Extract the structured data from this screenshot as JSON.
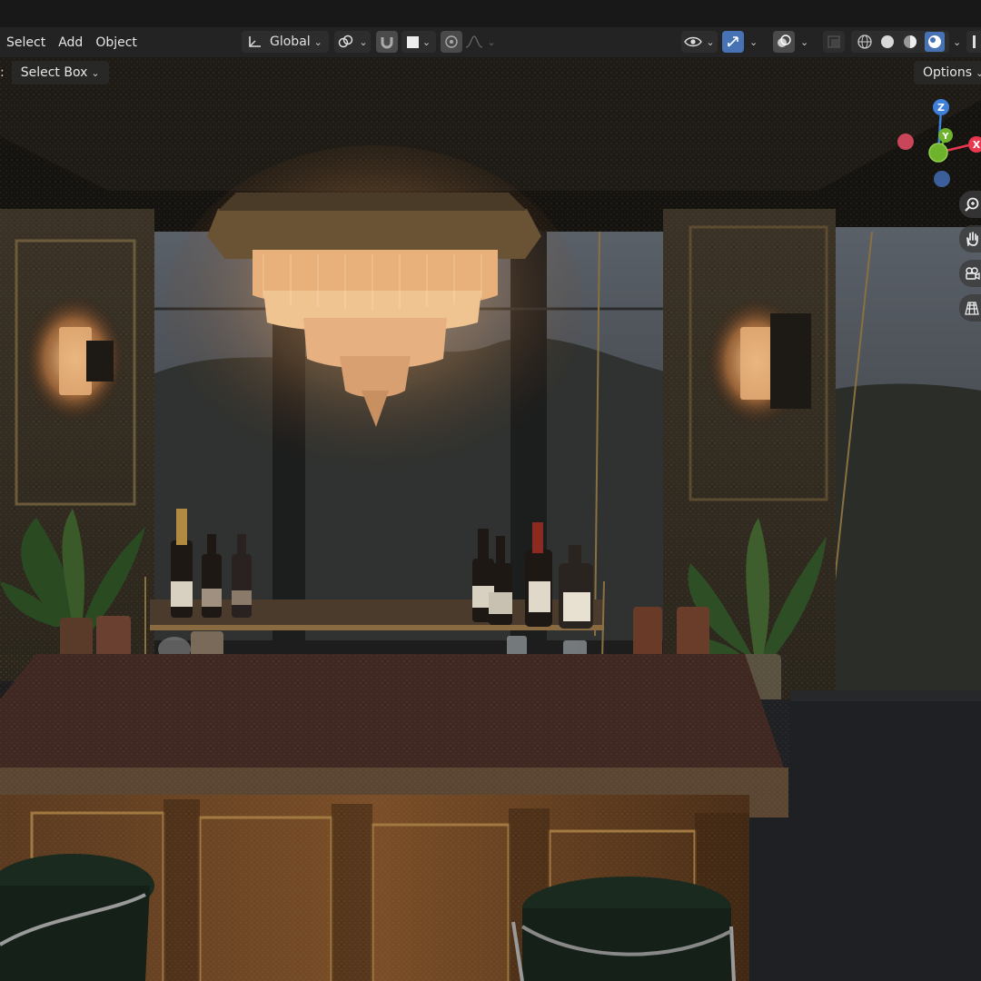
{
  "header": {
    "menu": [
      "Select",
      "Add",
      "Object"
    ],
    "transform_orientation": "Global"
  },
  "toolbar": {
    "mode_prefix": ":",
    "select_tool": "Select Box",
    "options_label": "Options"
  },
  "gizmo": {
    "z_label": "Z",
    "y_label": "Y",
    "x_label": "X"
  },
  "icons": {
    "transform": "axes-icon",
    "pivot": "link-icon",
    "snap": "magnet-icon",
    "proportional": "proportional-edit-icon",
    "visibility": "eye-icon",
    "gizmos": "gizmo-icon",
    "overlays": "overlay-icon",
    "xray": "xray-icon",
    "shading_wire": "wireframe-icon",
    "shading_solid": "solid-icon",
    "shading_material": "material-icon",
    "shading_rendered": "rendered-icon",
    "zoom": "zoom-icon",
    "pan": "hand-icon",
    "camera": "camera-icon",
    "grid": "grid-icon"
  },
  "colors": {
    "header_bg": "#232323",
    "active_accent": "#4772b3",
    "axis_x": "#e8384f",
    "axis_y": "#6fb32c",
    "axis_z": "#3d7fd9"
  }
}
